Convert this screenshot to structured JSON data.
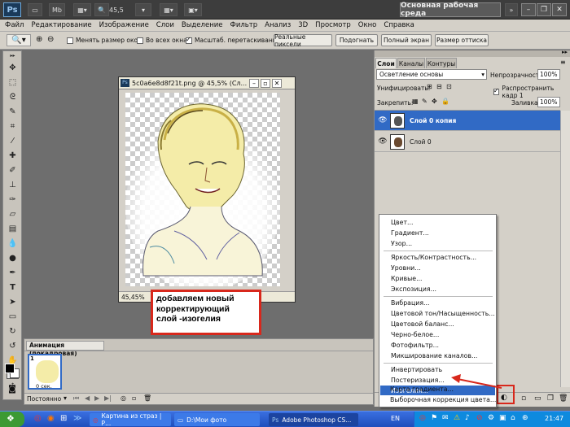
{
  "app": {
    "logo": "Ps",
    "zoom_value": "45,5",
    "mb_label": "Mb",
    "workspace_label": "Основная рабочая среда",
    "win_min": "–",
    "win_restore": "❐",
    "win_close": "✕"
  },
  "menu": [
    "Файл",
    "Редактирование",
    "Изображение",
    "Слои",
    "Выделение",
    "Фильтр",
    "Анализ",
    "3D",
    "Просмотр",
    "Окно",
    "Справка"
  ],
  "options": {
    "resize_windows": "Менять размер окон",
    "all_windows": "Во всех окнах",
    "scrubby_zoom": "Масштаб. перетаскиванием",
    "actual_pixels": "Реальные пиксели",
    "fit_screen": "Подогнать",
    "fill_screen": "Полный экран",
    "print_size": "Размер оттиска"
  },
  "document": {
    "title": "5c0a6e8d8f21t.png @ 45,5% (Сл...",
    "zoom": "45,45%"
  },
  "callout": {
    "line1": "добавляем новый",
    "line2": "корректирующий",
    "line3": "слой -изогелия"
  },
  "animation": {
    "tab": "Анимация (покадровая)",
    "frame_number": "1",
    "frame_delay": "0 сек.",
    "loop": "Постоянно"
  },
  "layers_panel": {
    "tabs": [
      "Слои",
      "Каналы",
      "Контуры"
    ],
    "blend_mode": "Осветление основы",
    "opacity_label": "Непрозрачность:",
    "opacity_value": "100%",
    "unify_label": "Унифицировать:",
    "propagate_label": "Распространить кадр 1",
    "lock_label": "Закрепить:",
    "fill_label": "Заливка:",
    "fill_value": "100%",
    "layers": [
      {
        "name": "Слой 0 копия",
        "selected": true
      },
      {
        "name": "Слой 0",
        "selected": false
      }
    ]
  },
  "adjustment_menu": {
    "group1": [
      "Цвет...",
      "Градиент...",
      "Узор..."
    ],
    "group2": [
      "Яркость/Контрастность...",
      "Уровни...",
      "Кривые...",
      "Экспозиция..."
    ],
    "group3": [
      "Вибрация...",
      "Цветовой тон/Насыщенность...",
      "Цветовой баланс...",
      "Черно-белое...",
      "Фотофильтр...",
      "Микширование каналов..."
    ],
    "group4": [
      "Инвертировать",
      "Постеризация...",
      "Изогелия...",
      "Карта градиента...",
      "Выборочная коррекция цвета..."
    ],
    "highlighted": "Изогелия..."
  },
  "taskbar": {
    "tasks": [
      "Картина из страз | Р...",
      "D:\\Мои фото",
      "Adobe Photoshop CS..."
    ],
    "lang": "EN",
    "clock": "21:47"
  },
  "colors": {
    "highlight": "#316ac5",
    "accent_red": "#d8281c",
    "taskbar": "#245edb",
    "start": "#3c9a34"
  }
}
